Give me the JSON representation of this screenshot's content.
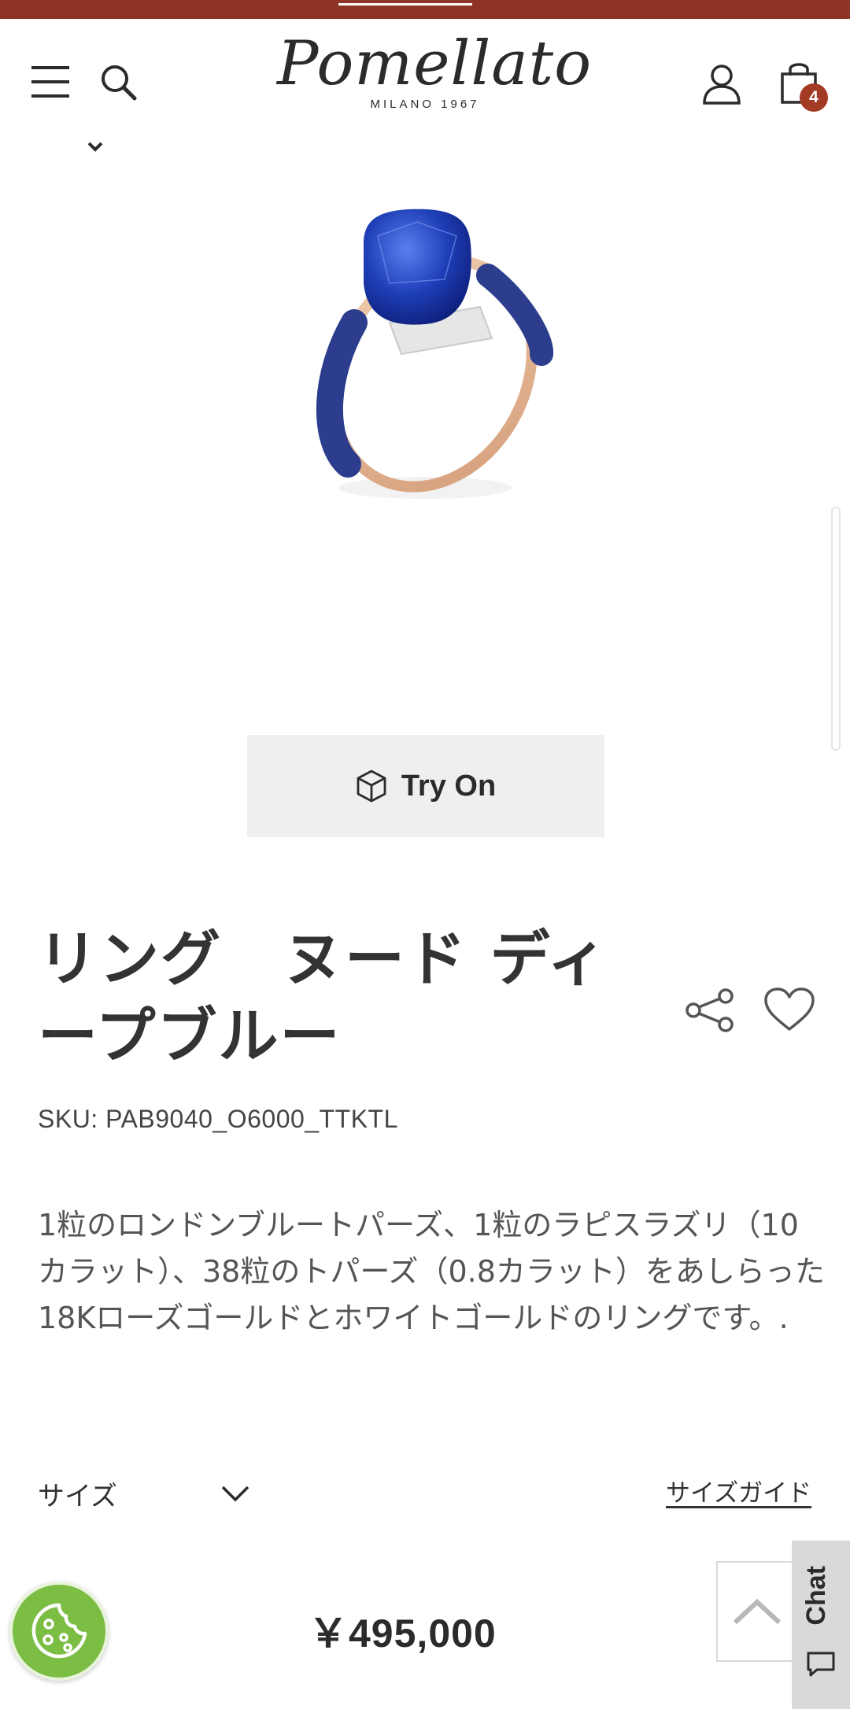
{
  "brand": {
    "logo_text": "Pomellato",
    "logo_sub": "MILANO 1967",
    "accent_color": "#8f3326"
  },
  "header": {
    "icons": [
      "menu-icon",
      "search-icon",
      "chevron-down-icon",
      "user-icon",
      "bag-icon"
    ],
    "cart_count": "4"
  },
  "product": {
    "try_on_label": "Try On",
    "title": "リング　ヌード ディープブルー",
    "sku": "SKU: PAB9040_O6000_TTKTL",
    "description": "1粒のロンドンブルートパーズ、1粒のラピスラズリ（10カラット）、38粒のトパーズ（0.8カラット）をあしらった18Kローズゴールドとホワイトゴールドのリングです。.",
    "size_label": "サイズ",
    "size_guide_label": "サイズガイド",
    "price": "￥495,000"
  },
  "widgets": {
    "chat_label": "Chat",
    "cookie_color": "#7cbd44"
  }
}
